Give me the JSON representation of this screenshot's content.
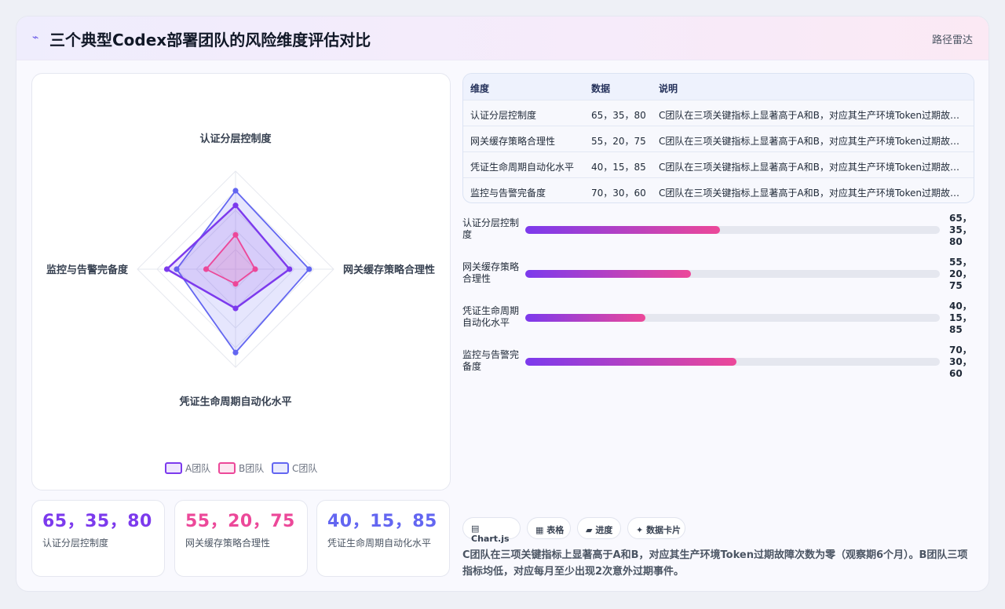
{
  "header": {
    "icon": "⌁",
    "title": "三个典型Codex部署团队的风险维度评估对比",
    "route": "路径雷达"
  },
  "chart_data": {
    "type": "radar",
    "axes": [
      "认证分层控制度",
      "网关缓存策略合理性",
      "凭证生命周期自动化水平",
      "监控与告警完备度"
    ],
    "range": [
      0,
      100
    ],
    "series": [
      {
        "name": "A团队",
        "values": [
          65,
          55,
          40,
          70
        ],
        "color": "#7c3aed"
      },
      {
        "name": "B团队",
        "values": [
          35,
          20,
          15,
          30
        ],
        "color": "#ec4899"
      },
      {
        "name": "C团队",
        "values": [
          80,
          75,
          85,
          60
        ],
        "color": "#6366f1"
      }
    ],
    "legend_position": "bottom"
  },
  "stats": [
    {
      "value": "65，35，80",
      "label": "认证分层控制度",
      "color": "#7c3aed"
    },
    {
      "value": "55，20，75",
      "label": "网关缓存策略合理性",
      "color": "#ec4899"
    },
    {
      "value": "40，15，85",
      "label": "凭证生命周期自动化水平",
      "color": "#6366f1"
    }
  ],
  "table": {
    "headers": [
      "维度",
      "数据",
      "说明"
    ],
    "rows": [
      [
        "认证分层控制度",
        "65，35，80",
        "C团队在三项关键指标上显著高于A和B，对应其生产环境Token过期故障次数为零（观察期6个月）。B团队三项指标均低，对应每月至少出现2次意外过期事件。"
      ],
      [
        "网关缓存策略合理性",
        "55，20，75",
        "C团队在三项关键指标上显著高于A和B，对应其生产环境Token过期故障次数为零（观察期6个月）。B团队三项指标均低，对应每月至少出现2次意外过期事件。"
      ],
      [
        "凭证生命周期自动化水平",
        "40，15，85",
        "C团队在三项关键指标上显著高于A和B，对应其生产环境Token过期故障次数为零（观察期6个月）。B团队三项指标均低，对应每月至少出现2次意外过期事件。"
      ],
      [
        "监控与告警完备度",
        "70，30，60",
        "C团队在三项关键指标上显著高于A和B，对应其生产环境Token过期故障次数为零（观察期6个月）。B团队三项指标均低，对应每月至少出现2次意外过期事件。"
      ]
    ]
  },
  "bars": [
    {
      "label": "认证分层控制度",
      "value_text": "65，35，80",
      "progress": 0.47
    },
    {
      "label": "网关缓存策略合理性",
      "value_text": "55，20，75",
      "progress": 0.4
    },
    {
      "label": "凭证生命周期自动化水平",
      "value_text": "40，15，85",
      "progress": 0.29
    },
    {
      "label": "监控与告警完备度",
      "value_text": "70，30，60",
      "progress": 0.51
    }
  ],
  "chips": [
    {
      "icon": "▤",
      "label": "Chart.js"
    },
    {
      "icon": "▦",
      "label": "表格"
    },
    {
      "icon": "▰",
      "label": "进度"
    },
    {
      "icon": "✦",
      "label": "数据卡片"
    }
  ],
  "note": "C团队在三项关键指标上显著高于A和B，对应其生产环境Token过期故障次数为零（观察期6个月）。B团队三项指标均低，对应每月至少出现2次意外过期事件。"
}
